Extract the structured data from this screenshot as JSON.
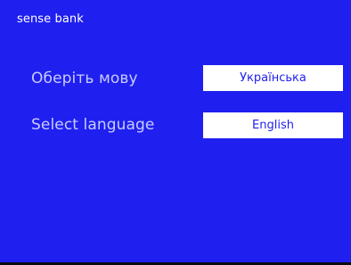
{
  "brand": {
    "logo_text": "sense bank"
  },
  "language_select": {
    "prompt_ua": "Оберіть мову",
    "prompt_en": "Select language",
    "option_ua": "Українська",
    "option_en": "English"
  },
  "colors": {
    "background": "#1f1ff0",
    "label": "#c9ccff",
    "button_bg": "#ffffff",
    "button_text": "#1f1ff0"
  }
}
